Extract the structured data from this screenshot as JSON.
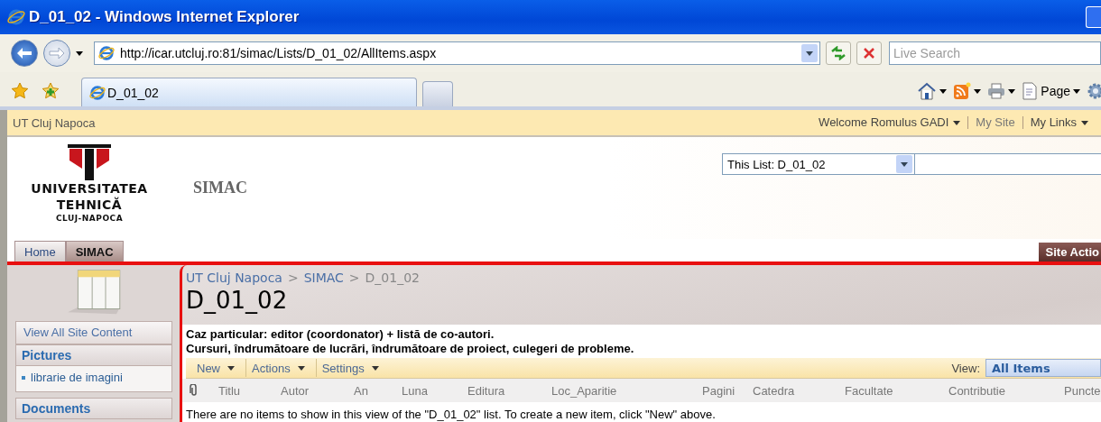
{
  "window": {
    "title": "D_01_02 - Windows Internet Explorer"
  },
  "address_bar": {
    "url": "http://icar.utcluj.ro:81/simac/Lists/D_01_02/AllItems.aspx"
  },
  "search": {
    "placeholder": "Live Search"
  },
  "tabs": [
    {
      "label": "D_01_02",
      "selected": true
    }
  ],
  "command_bar": {
    "page_label": "Page"
  },
  "site": {
    "top_link": "UT Cluj Napoca",
    "welcome": "Welcome Romulus GADI",
    "links": [
      "My Site",
      "My Links"
    ],
    "logo_lines": [
      "UNIVERSITATEA",
      "TEHNICĂ",
      "CLUJ-NAPOCA"
    ],
    "site_title": "SIMAC",
    "search_scope": "This List: D_01_02",
    "nav_tabs": [
      {
        "label": "Home",
        "selected": false
      },
      {
        "label": "SIMAC",
        "selected": true
      }
    ],
    "site_actions": "Site Actio"
  },
  "sidebar": {
    "view_all": "View All Site Content",
    "sections": [
      {
        "heading": "Pictures",
        "items": [
          "librarie de imagini"
        ]
      },
      {
        "heading": "Documents"
      }
    ]
  },
  "main": {
    "breadcrumb": [
      "UT Cluj Napoca",
      "SIMAC",
      "D_01_02"
    ],
    "separator": ">",
    "title": "D_01_02",
    "description": [
      "Caz particular: editor (coordonator) + listă de co-autori.",
      "Cursuri, îndrumătoare de lucrări, îndrumătoare de proiect, culegeri de probleme."
    ],
    "toolbar": [
      "New",
      "Actions",
      "Settings"
    ],
    "view_label": "View:",
    "view": "All Items",
    "columns": [
      "Titlu",
      "Autor",
      "An",
      "Luna",
      "Editura",
      "Loc_Aparitie",
      "Pagini",
      "Catedra",
      "Facultate",
      "Contributie",
      "Puncte"
    ],
    "empty_message": "There are no items to show in this view of the \"D_01_02\" list. To create a new item, click \"New\" above."
  }
}
